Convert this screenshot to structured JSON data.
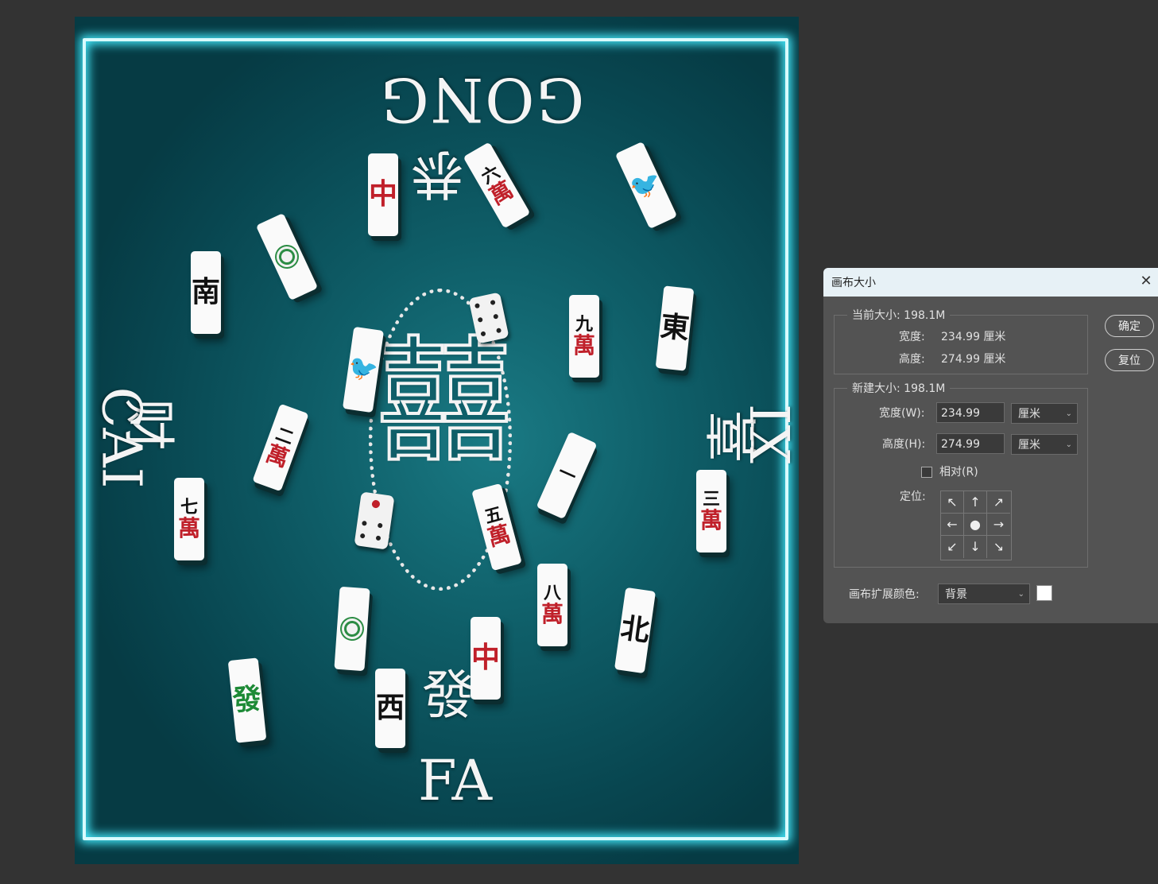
{
  "canvas": {
    "top_text": "GONG",
    "left_text_cn": "财",
    "left_text_en": "CAI",
    "right_text_cn": "喜",
    "right_text_en": "XI",
    "bottom_text_cn": "發",
    "bottom_text_en": "FA",
    "center_text": "囍",
    "top_center_cn": "恭",
    "tiles": {
      "zhong_top": "中",
      "nan": "南",
      "dong": "東",
      "bei": "北",
      "xi": "西",
      "fa": "發",
      "zhong_bottom": "中",
      "jiu_top": "九",
      "jiu_bot": "萬",
      "san_top": "三",
      "san_bot": "萬",
      "qi_top": "七",
      "qi_bot": "萬",
      "ba_top": "八",
      "ba_bot": "萬",
      "wu_top": "五",
      "wu_bot": "萬",
      "er_top": "二",
      "er_bot": "萬",
      "liu_top": "六",
      "liu_bot": "萬",
      "yi": "一"
    }
  },
  "dialog": {
    "title": "画布大小",
    "current_size_label": "当前大小: 198.1M",
    "width_label": "宽度:",
    "width_value": "234.99 厘米",
    "height_label": "高度:",
    "height_value": "274.99 厘米",
    "new_size_label": "新建大小: 198.1M",
    "new_width_label": "宽度(W):",
    "new_width_value": "234.99",
    "new_height_label": "高度(H):",
    "new_height_value": "274.99",
    "unit": "厘米",
    "relative_label": "相对(R)",
    "anchor_label": "定位:",
    "extension_color_label": "画布扩展颜色:",
    "extension_color_value": "背景",
    "ok_button": "确定",
    "reset_button": "复位",
    "swatch_color": "#ffffff"
  }
}
